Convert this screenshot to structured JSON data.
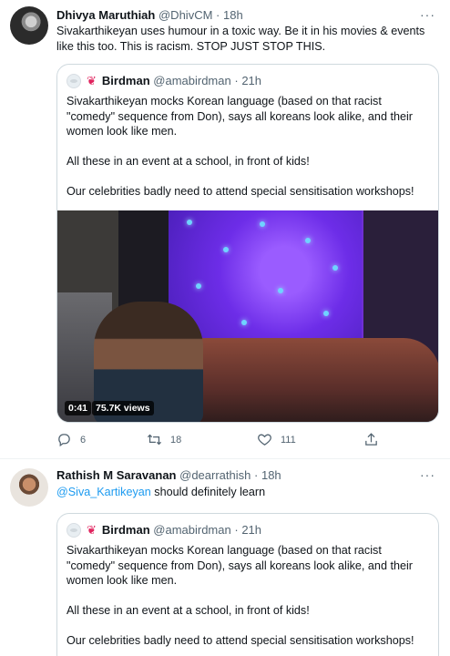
{
  "tweets": [
    {
      "author_name": "Dhivya Maruthiah",
      "author_handle": "@DhivCM",
      "time": "18h",
      "text": "Sivakarthikeyan uses humour in a toxic way. Be it in his movies & events like this too. This is racism. STOP JUST STOP THIS.",
      "quote": {
        "author_name": "Birdman",
        "author_handle": "@amabirdman",
        "time": "21h",
        "paragraphs": [
          "Sivakarthikeyan mocks Korean language (based on that racist \"comedy\" sequence from Don), says all koreans look alike, and their women look like men.",
          "All these in an event at a school, in front of kids!",
          "Our celebrities badly need to attend special sensitisation workshops!"
        ],
        "media": {
          "duration": "0:41",
          "views": "75.7K views"
        }
      },
      "actions": {
        "replies": "6",
        "retweets": "18",
        "likes": "111"
      }
    },
    {
      "author_name": "Rathish M Saravanan",
      "author_handle": "@dearrathish",
      "time": "18h",
      "mention": "@Siva_Kartikeyan",
      "text_after_mention": " should definitely learn",
      "quote": {
        "author_name": "Birdman",
        "author_handle": "@amabirdman",
        "time": "21h",
        "paragraphs": [
          "Sivakarthikeyan mocks Korean language (based on that racist \"comedy\" sequence from Don), says all koreans look alike, and their women look like men.",
          "All these in an event at a school, in front of kids!",
          "Our celebrities badly need to attend special sensitisation workshops!"
        ]
      }
    }
  ],
  "ui": {
    "separator": "·",
    "more_glyph": "···",
    "bird_glyph": "❦"
  },
  "icons": {
    "reply": "reply-icon",
    "retweet": "retweet-icon",
    "like": "heart-icon",
    "share": "share-icon",
    "more": "more-icon"
  },
  "colors": {
    "link": "#1d9bf0",
    "muted": "#536471",
    "text": "#0f1419",
    "border": "#cfd9de",
    "bird": "#e0245e"
  }
}
